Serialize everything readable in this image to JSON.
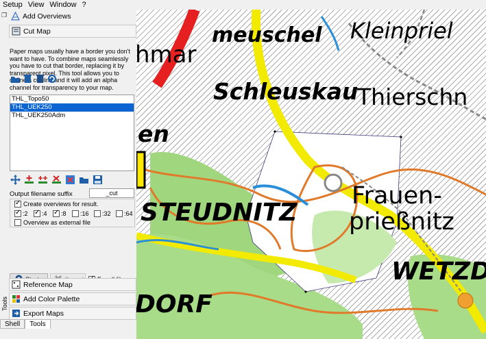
{
  "menu": [
    "Setup",
    "View",
    "Window",
    "?"
  ],
  "sections": {
    "add_overviews": "Add Overviews",
    "cut_map": "Cut Map",
    "reference_map": "Reference Map",
    "add_color_palette": "Add Color Palette",
    "export_maps": "Export Maps"
  },
  "description": "Paper maps usually have a border you don't want to have. To combine maps seamlessly you have to cut that border, replacing it by transparent pixel. This tool allows you to define a cut line and it will add an alpha channel for transparency to your map.",
  "map_list": [
    "THL_Topo50",
    "THL_UEK250",
    "THL_UEK250Adm"
  ],
  "selected_index": 1,
  "output_suffix": {
    "label": "Output filename suffix",
    "value": "_cut"
  },
  "options": {
    "create_overviews_label": "Create overviews for result.",
    "create_overviews_checked": true,
    "levels": [
      {
        "label": ":2",
        "checked": true
      },
      {
        "label": ":4",
        "checked": true
      },
      {
        "label": ":8",
        "checked": true
      },
      {
        "label": ":16",
        "checked": false
      },
      {
        "label": ":32",
        "checked": false
      },
      {
        "label": ":64",
        "checked": false
      }
    ],
    "external_label": "Overview as external file",
    "external_checked": false
  },
  "actions": {
    "start_label": "Start",
    "cancel_label": "Cancel",
    "for_all_files_label": "For all files",
    "for_all_files_checked": true
  },
  "tabs": [
    "Shell",
    "Tools"
  ],
  "active_tab": "Tools",
  "side_label": "Tools",
  "map_labels": {
    "meuschel": "meuschel",
    "kleinpriel": "Kleinpriel",
    "hmar": "hmar",
    "schleuskau": "Schleuskau",
    "thierschn": "Thierschn",
    "en": "en",
    "steudnitz": "STEUDNITZ",
    "frauen": "Frauen-",
    "priessnitz": "prießnitz",
    "wetzd": "WETZD",
    "dorf": "DORF"
  },
  "colors": {
    "selection": "#0a64d2",
    "road_yellow": "#f2ea00",
    "road_red": "#e62020",
    "river_blue": "#2a8fd8",
    "orange_line": "#e07a2a",
    "forest_green": "#9fd67e"
  }
}
